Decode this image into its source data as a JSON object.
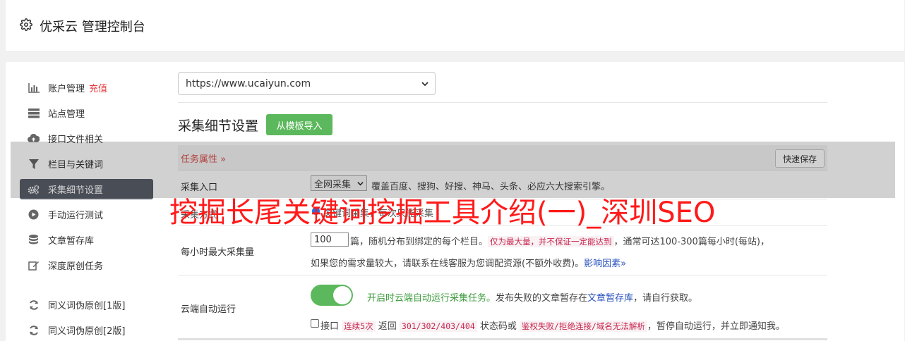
{
  "header": {
    "title": "优采云 管理控制台",
    "icon": "gear-icon"
  },
  "sidebar": {
    "items": [
      {
        "label": "账户管理",
        "badge": "充值",
        "icon": "bar-chart-icon"
      },
      {
        "label": "站点管理",
        "icon": "server-icon"
      },
      {
        "label": "接口文件相关",
        "icon": "cloud-upload-icon"
      },
      {
        "label": "栏目与关键词",
        "icon": "filter-icon"
      },
      {
        "label": "采集细节设置",
        "icon": "cogs-icon",
        "active": true
      },
      {
        "label": "手动运行测试",
        "icon": "play-circle-icon"
      },
      {
        "label": "文章暂存库",
        "icon": "database-icon"
      },
      {
        "label": "深度原创任务",
        "icon": "edit-icon"
      },
      {
        "label": "同义词伪原创[1版]",
        "icon": "refresh-icon"
      },
      {
        "label": "同义词伪原创[2版]",
        "icon": "refresh-icon"
      }
    ]
  },
  "site_select": {
    "value": "https://www.ucaiyun.com"
  },
  "section": {
    "title": "采集细节设置",
    "import_button": "从模板导入"
  },
  "task_bar": {
    "label": "任务属性 »",
    "quick_save": "快速保存"
  },
  "rows": {
    "entry": {
      "label": "采集入口",
      "select_value": "全网采集",
      "desc": "覆盖百度、搜狗、好搜、神马、头条、必应六大搜索引擎。"
    },
    "hidden": {
      "label": "采集方式",
      "text": "关键词采集，每次只能采集"
    },
    "max": {
      "label": "每小时最大采集量",
      "input_value": "100",
      "text1": "篇，随机分布到绑定的每个栏目。",
      "code1": "仅为最大量，并不保证一定能达到",
      "text2": "，通常可达100-300篇每小时(每站)，",
      "text3": "如果您的需求量较大，请联系在线客服为您调配资源(不额外收费)。",
      "link": "影响因素»"
    },
    "cloud": {
      "label": "云端自动运行",
      "toggle_on": true,
      "green_text": "开启时云端自动运行采集任务。",
      "text1": "发布失败的文章暂存在",
      "link": "文章暂存库",
      "text2": "，请自行获取。",
      "cb_text1": "接口",
      "code1": "连续5次",
      "cb_text2": "返回",
      "code2": "301/302/403/404",
      "cb_text3": "状态码或",
      "code3": "鉴权失败/拒绝连接/域名无法解析",
      "cb_text4": "，暂停自动运行，并立即通知我。"
    }
  },
  "watermark": "挖掘长尾关键词挖掘工具介绍(一)_深圳SEO",
  "colors": {
    "active_sidebar": "#5a5f69",
    "green": "#5cb85c",
    "red": "#ff1a1a",
    "badge": "#e4393c"
  }
}
